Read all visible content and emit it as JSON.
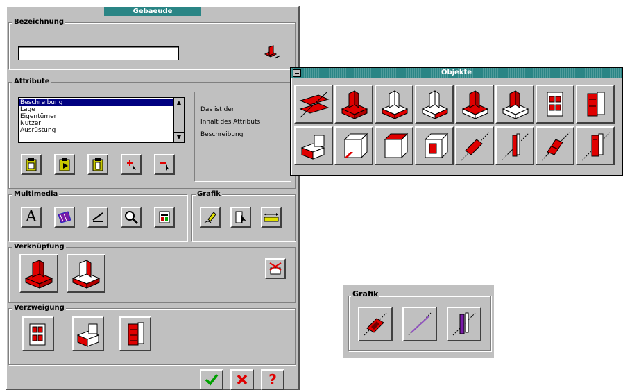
{
  "main_window": {
    "title": "Gebaeude",
    "bezeichnung": {
      "label": "Bezeichnung",
      "value": ""
    },
    "attribute": {
      "label": "Attribute",
      "items": [
        "Beschreibung",
        "Lage",
        "Eigentümer",
        "Nutzer",
        "Ausrüstung"
      ],
      "selected_index": 0,
      "info_lines": [
        "Das ist der",
        "Inhalt des Attributs",
        "Beschreibung"
      ]
    },
    "multimedia": {
      "label": "Multimedia",
      "text_glyph": "A"
    },
    "grafik": {
      "label": "Grafik"
    },
    "verknuepfung": {
      "label": "Verknüpfung"
    },
    "verzweigung": {
      "label": "Verzweigung"
    },
    "footer": {
      "help_glyph": "?"
    }
  },
  "objekte_window": {
    "title": "Objekte"
  },
  "grafik_palette": {
    "label": "Grafik"
  },
  "colors": {
    "titlebar": "#2a8585",
    "red": "#e00000",
    "purple": "#7a1aa8",
    "ok_green": "#00a000"
  }
}
